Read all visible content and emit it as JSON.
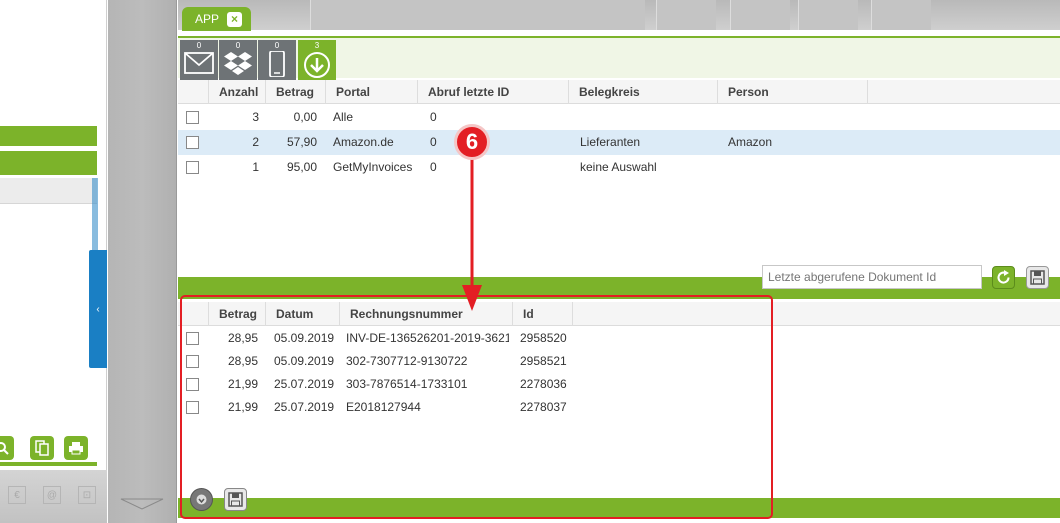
{
  "tab": {
    "label": "APP",
    "close_glyph": "×"
  },
  "portals": [
    {
      "icon": "mail-icon",
      "count": "0"
    },
    {
      "icon": "dropbox-icon",
      "count": "0"
    },
    {
      "icon": "mobile-icon",
      "count": "0"
    },
    {
      "icon": "download-icon",
      "count": "3",
      "active": true
    }
  ],
  "top_grid": {
    "headers": [
      "Anzahl",
      "Betrag",
      "Portal",
      "Abruf letzte ID",
      "Belegkreis",
      "Person"
    ],
    "rows": [
      {
        "anzahl": "3",
        "betrag": "0,00",
        "portal": "Alle",
        "abruf": "0",
        "belegkreis": "",
        "person": ""
      },
      {
        "anzahl": "2",
        "betrag": "57,90",
        "portal": "Amazon.de",
        "abruf": "0",
        "belegkreis": "Lieferanten",
        "person": "Amazon",
        "selected": true
      },
      {
        "anzahl": "1",
        "betrag": "95,00",
        "portal": "GetMyInvoices",
        "abruf": "0",
        "belegkreis": "keine Auswahl",
        "person": ""
      }
    ]
  },
  "last_id": {
    "placeholder": "Letzte abgerufene Dokument Id"
  },
  "bottom_grid": {
    "headers": [
      "Betrag",
      "Datum",
      "Rechnungsnummer",
      "Id"
    ],
    "rows": [
      {
        "betrag": "28,95",
        "datum": "05.09.2019",
        "nummer": "INV-DE-136526201-2019-3621",
        "id": "2958520"
      },
      {
        "betrag": "28,95",
        "datum": "05.09.2019",
        "nummer": "302-7307712-9130722",
        "id": "2958521"
      },
      {
        "betrag": "21,99",
        "datum": "25.07.2019",
        "nummer": "303-7876514-1733101",
        "id": "2278036"
      },
      {
        "betrag": "21,99",
        "datum": "25.07.2019",
        "nummer": "E2018127944",
        "id": "2278037"
      }
    ]
  },
  "annotation": {
    "badge": "6",
    "color": "#e31e24"
  },
  "left_panel": {
    "collapse_glyph": "‹",
    "footer_icons": [
      "€",
      "@",
      "⊡"
    ]
  },
  "colors": {
    "accent": "#7cb32a",
    "selection": "#dcebf7",
    "portal_button": "#6e7376"
  }
}
